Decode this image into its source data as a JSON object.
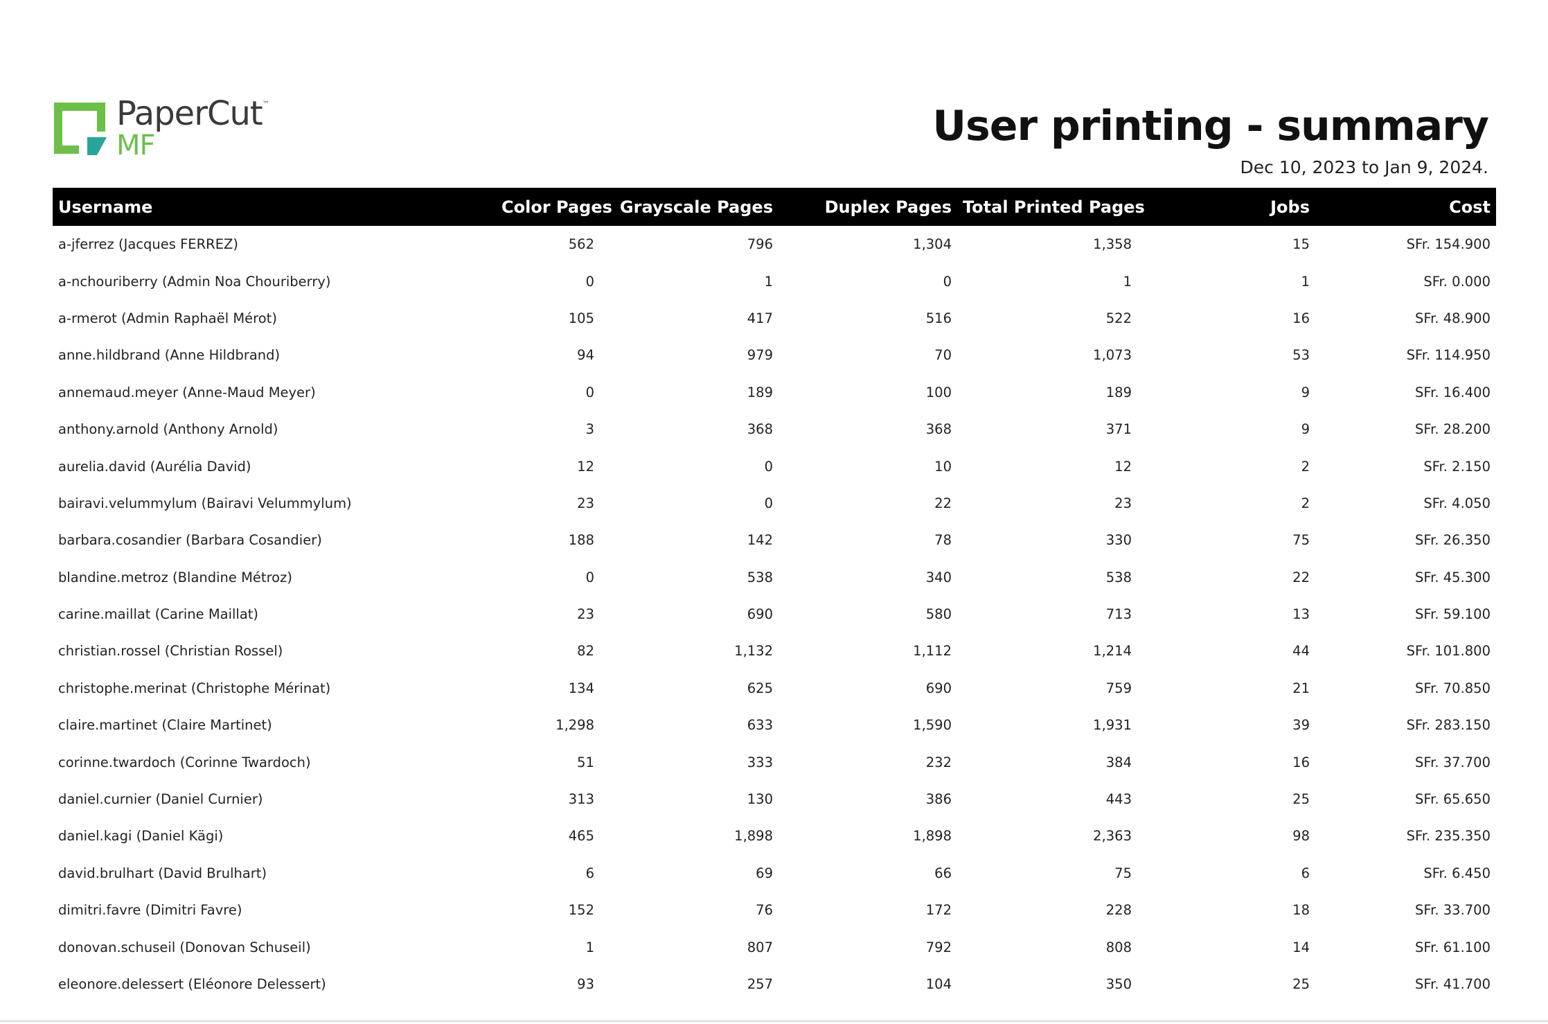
{
  "logo": {
    "brand": "PaperCut",
    "trademark": "™",
    "sub": "MF",
    "colors": {
      "green": "#6cc04a",
      "teal": "#2aa59a",
      "text": "#3a3a3a"
    }
  },
  "report": {
    "title": "User printing - summary",
    "date_range": "Dec 10, 2023 to Jan 9, 2024."
  },
  "table": {
    "headers": {
      "username": "Username",
      "color_pages": "Color Pages",
      "grayscale_pages": "Grayscale Pages",
      "duplex_pages": "Duplex Pages",
      "total_printed_pages": "Total Printed Pages",
      "jobs": "Jobs",
      "cost": "Cost"
    },
    "rows": [
      {
        "username": "a-jferrez (Jacques FERREZ)",
        "color": "562",
        "gray": "796",
        "duplex": "1,304",
        "total": "1,358",
        "jobs": "15",
        "cost": "SFr. 154.900"
      },
      {
        "username": "a-nchouriberry (Admin Noa Chouriberry)",
        "color": "0",
        "gray": "1",
        "duplex": "0",
        "total": "1",
        "jobs": "1",
        "cost": "SFr. 0.000"
      },
      {
        "username": "a-rmerot (Admin Raphaël Mérot)",
        "color": "105",
        "gray": "417",
        "duplex": "516",
        "total": "522",
        "jobs": "16",
        "cost": "SFr. 48.900"
      },
      {
        "username": "anne.hildbrand (Anne Hildbrand)",
        "color": "94",
        "gray": "979",
        "duplex": "70",
        "total": "1,073",
        "jobs": "53",
        "cost": "SFr. 114.950"
      },
      {
        "username": "annemaud.meyer (Anne-Maud Meyer)",
        "color": "0",
        "gray": "189",
        "duplex": "100",
        "total": "189",
        "jobs": "9",
        "cost": "SFr. 16.400"
      },
      {
        "username": "anthony.arnold (Anthony Arnold)",
        "color": "3",
        "gray": "368",
        "duplex": "368",
        "total": "371",
        "jobs": "9",
        "cost": "SFr. 28.200"
      },
      {
        "username": "aurelia.david (Aurélia David)",
        "color": "12",
        "gray": "0",
        "duplex": "10",
        "total": "12",
        "jobs": "2",
        "cost": "SFr. 2.150"
      },
      {
        "username": "bairavi.velummylum (Bairavi Velummylum)",
        "color": "23",
        "gray": "0",
        "duplex": "22",
        "total": "23",
        "jobs": "2",
        "cost": "SFr. 4.050"
      },
      {
        "username": "barbara.cosandier (Barbara Cosandier)",
        "color": "188",
        "gray": "142",
        "duplex": "78",
        "total": "330",
        "jobs": "75",
        "cost": "SFr. 26.350"
      },
      {
        "username": "blandine.metroz (Blandine Métroz)",
        "color": "0",
        "gray": "538",
        "duplex": "340",
        "total": "538",
        "jobs": "22",
        "cost": "SFr. 45.300"
      },
      {
        "username": "carine.maillat (Carine Maillat)",
        "color": "23",
        "gray": "690",
        "duplex": "580",
        "total": "713",
        "jobs": "13",
        "cost": "SFr. 59.100"
      },
      {
        "username": "christian.rossel (Christian Rossel)",
        "color": "82",
        "gray": "1,132",
        "duplex": "1,112",
        "total": "1,214",
        "jobs": "44",
        "cost": "SFr. 101.800"
      },
      {
        "username": "christophe.merinat (Christophe Mérinat)",
        "color": "134",
        "gray": "625",
        "duplex": "690",
        "total": "759",
        "jobs": "21",
        "cost": "SFr. 70.850"
      },
      {
        "username": "claire.martinet (Claire Martinet)",
        "color": "1,298",
        "gray": "633",
        "duplex": "1,590",
        "total": "1,931",
        "jobs": "39",
        "cost": "SFr. 283.150"
      },
      {
        "username": "corinne.twardoch (Corinne Twardoch)",
        "color": "51",
        "gray": "333",
        "duplex": "232",
        "total": "384",
        "jobs": "16",
        "cost": "SFr. 37.700"
      },
      {
        "username": "daniel.curnier (Daniel Curnier)",
        "color": "313",
        "gray": "130",
        "duplex": "386",
        "total": "443",
        "jobs": "25",
        "cost": "SFr. 65.650"
      },
      {
        "username": "daniel.kagi (Daniel Kägi)",
        "color": "465",
        "gray": "1,898",
        "duplex": "1,898",
        "total": "2,363",
        "jobs": "98",
        "cost": "SFr. 235.350"
      },
      {
        "username": "david.brulhart (David Brulhart)",
        "color": "6",
        "gray": "69",
        "duplex": "66",
        "total": "75",
        "jobs": "6",
        "cost": "SFr. 6.450"
      },
      {
        "username": "dimitri.favre (Dimitri Favre)",
        "color": "152",
        "gray": "76",
        "duplex": "172",
        "total": "228",
        "jobs": "18",
        "cost": "SFr. 33.700"
      },
      {
        "username": "donovan.schuseil (Donovan Schuseil)",
        "color": "1",
        "gray": "807",
        "duplex": "792",
        "total": "808",
        "jobs": "14",
        "cost": "SFr. 61.100"
      },
      {
        "username": "eleonore.delessert (Eléonore Delessert)",
        "color": "93",
        "gray": "257",
        "duplex": "104",
        "total": "350",
        "jobs": "25",
        "cost": "SFr. 41.700"
      }
    ]
  }
}
